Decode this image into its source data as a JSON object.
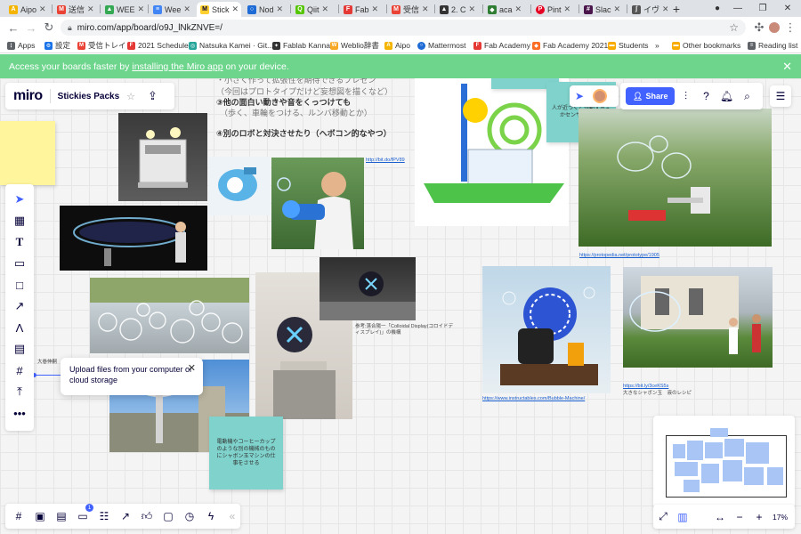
{
  "browser": {
    "tabs": [
      {
        "label": "Aipo",
        "color": "#f4b400",
        "glyph": "A"
      },
      {
        "label": "送信",
        "color": "#ea4335",
        "glyph": "M"
      },
      {
        "label": "WEE",
        "color": "#34a853",
        "glyph": "▲"
      },
      {
        "label": "Wee",
        "color": "#4285f4",
        "glyph": "≡"
      },
      {
        "label": "Stick",
        "color": "#ffd02f",
        "glyph": "M"
      },
      {
        "label": "Nod",
        "color": "#1e6bd6",
        "glyph": "○"
      },
      {
        "label": "Qiit",
        "color": "#55c500",
        "glyph": "Q"
      },
      {
        "label": "Fab",
        "color": "#e53935",
        "glyph": "F"
      },
      {
        "label": "受信",
        "color": "#ea4335",
        "glyph": "M"
      },
      {
        "label": "2. C",
        "color": "#333333",
        "glyph": "▲"
      },
      {
        "label": "aca",
        "color": "#2e7d32",
        "glyph": "◆"
      },
      {
        "label": "Pint",
        "color": "#e60023",
        "glyph": "P"
      },
      {
        "label": "Slac",
        "color": "#4a154b",
        "glyph": "#"
      },
      {
        "label": "イヴ",
        "color": "#555555",
        "glyph": "ʃ"
      }
    ],
    "url": "miro.com/app/board/o9J_lNkZNVE=/",
    "bookmarks": [
      {
        "label": "Apps",
        "color": "#5f6368"
      },
      {
        "label": "設定",
        "color": "#1a73e8"
      },
      {
        "label": "受信トレイ",
        "color": "#ea4335"
      },
      {
        "label": "2021 Schedule",
        "color": "#e53935"
      },
      {
        "label": "Natsuka Kamei · Git...",
        "color": "#26a69a"
      },
      {
        "label": "Fablab Kannai",
        "color": "#333333"
      },
      {
        "label": "Weblio辞書",
        "color": "#f9a825"
      },
      {
        "label": "Aipo",
        "color": "#f4b400"
      },
      {
        "label": "Mattermost",
        "color": "#1e6bd6"
      },
      {
        "label": "Fab Academy",
        "color": "#e53935"
      },
      {
        "label": "Fab Academy 2021",
        "color": "#fc6d26"
      },
      {
        "label": "Students",
        "color": "#f9ab00"
      },
      {
        "label": "Other bookmarks",
        "color": "#f9ab00"
      },
      {
        "label": "Reading list",
        "color": "#5f6368"
      }
    ],
    "bookmark_more": "»"
  },
  "banner": {
    "text_before": "Access your boards faster by",
    "link": "installing the Miro app",
    "text_after": "on your device."
  },
  "miro": {
    "logo": "miro",
    "board_name": "Stickies Packs",
    "share_label": "Share",
    "upload_tip": "Upload files from your computer or cloud storage",
    "zoom": "17%",
    "notification_count": "1"
  },
  "board": {
    "top_text": [
      "・小さく作って拡張性を期待できるプレゼン",
      "（今回はプロトタイプだけど妄想図を描くなど）",
      "③他の面白い動きや音をくっつけても",
      "（歩く、車輪をつける、ルンバ移動とか）",
      "④別のロボと対決させたり（ヘボコン的なやつ）"
    ],
    "links": {
      "bit_ly_1": "http://bit.do/fPV89",
      "protospedia": "https://protopedia.net/prototype/1905",
      "instructables": "https://www.instructables.com/Bubble-Machine/",
      "bit_ly_2": "https://bit.ly/3ceKS5s"
    },
    "notes": {
      "reference": "参考:落合陽一「Colloidal Display(コロイドディスプレイ)」の機構",
      "big_bubble": "大きなシャボン玉　液のレシピ",
      "left_label": "大巻伸嗣"
    },
    "stickies": {
      "teal_top": "人が近づくと作動するよかセンサーつける",
      "teal_bottom": "電動機やコーヒーカップのような別の機械のものにシャボン玉マシンの仕事をさせる"
    }
  },
  "colors": {
    "banner": "#6dd58c",
    "accent": "#4262ff",
    "sticky_yellow": "#fff59d",
    "sticky_teal": "#7fd3cc"
  }
}
